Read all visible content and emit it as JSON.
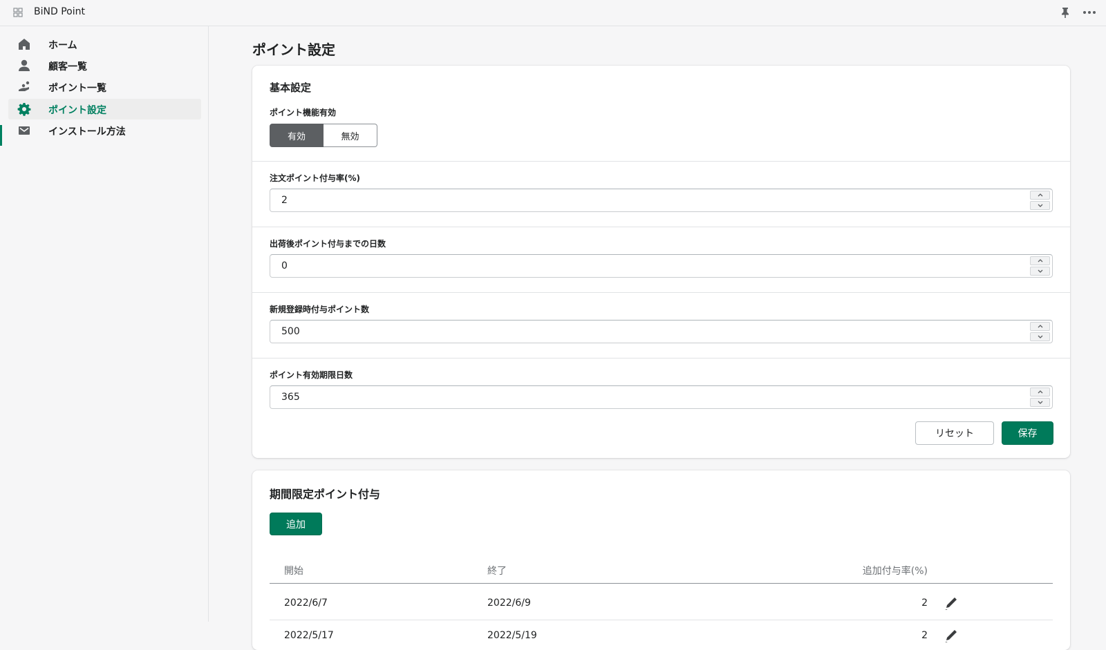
{
  "app": {
    "title": "BiND Point"
  },
  "colors": {
    "accent": "#008060",
    "primary_button": "#007a5a",
    "toggle_on": "#5c5f62"
  },
  "sidebar": {
    "items": [
      {
        "label": "ホーム",
        "icon": "home-icon"
      },
      {
        "label": "顧客一覧",
        "icon": "person-icon"
      },
      {
        "label": "ポイント一覧",
        "icon": "coins-icon"
      },
      {
        "label": "ポイント設定",
        "icon": "gear-icon",
        "active": true
      },
      {
        "label": "インストール方法",
        "icon": "mail-icon"
      }
    ]
  },
  "page": {
    "title": "ポイント設定"
  },
  "basic": {
    "section_title": "基本設定",
    "enabled_label": "ポイント機能有効",
    "enabled_on": "有効",
    "enabled_off": "無効",
    "selected": "有効",
    "fields": [
      {
        "label": "注文ポイント付与率(%)",
        "value": "2"
      },
      {
        "label": "出荷後ポイント付与までの日数",
        "value": "0"
      },
      {
        "label": "新規登録時付与ポイント数",
        "value": "500"
      },
      {
        "label": "ポイント有効期限日数",
        "value": "365"
      }
    ],
    "reset_label": "リセット",
    "save_label": "保存"
  },
  "campaign": {
    "section_title": "期間限定ポイント付与",
    "add_label": "追加",
    "columns": [
      "開始",
      "終了",
      "追加付与率(%)"
    ],
    "rows": [
      {
        "start": "2022/6/7",
        "end": "2022/6/9",
        "rate": "2"
      },
      {
        "start": "2022/5/17",
        "end": "2022/5/19",
        "rate": "2"
      }
    ]
  }
}
